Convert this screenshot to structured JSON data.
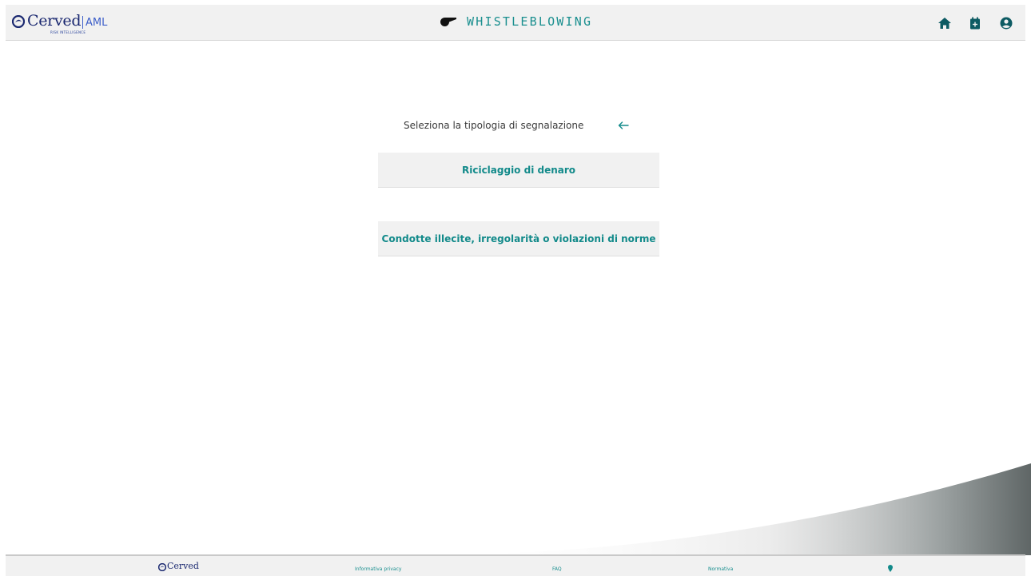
{
  "header": {
    "brand": {
      "name": "Cerved",
      "subtitle": "RISK INTELLIGENCE",
      "product": "AML"
    },
    "app_title": "WHISTLEBLOWING",
    "icons": [
      "home-icon",
      "calendar-add-icon",
      "user-circle-icon"
    ]
  },
  "main": {
    "prompt": "Seleziona la tipologia di segnalazione",
    "back_icon": "arrow-left-icon",
    "options": [
      {
        "label": "Riciclaggio di denaro"
      },
      {
        "label": "Condotte illecite, irregolarità o violazioni di norme"
      }
    ]
  },
  "footer": {
    "brand": "Cerved",
    "links": {
      "privacy": "Informativa privacy",
      "faq": "FAQ",
      "normativa": "Normativa"
    },
    "pin_icon": "map-pin-icon"
  },
  "colors": {
    "accent": "#128a8a",
    "brand_navy": "#1a2870",
    "brand_blue": "#3d5fc9",
    "bar_bg": "#f1f1f1"
  }
}
